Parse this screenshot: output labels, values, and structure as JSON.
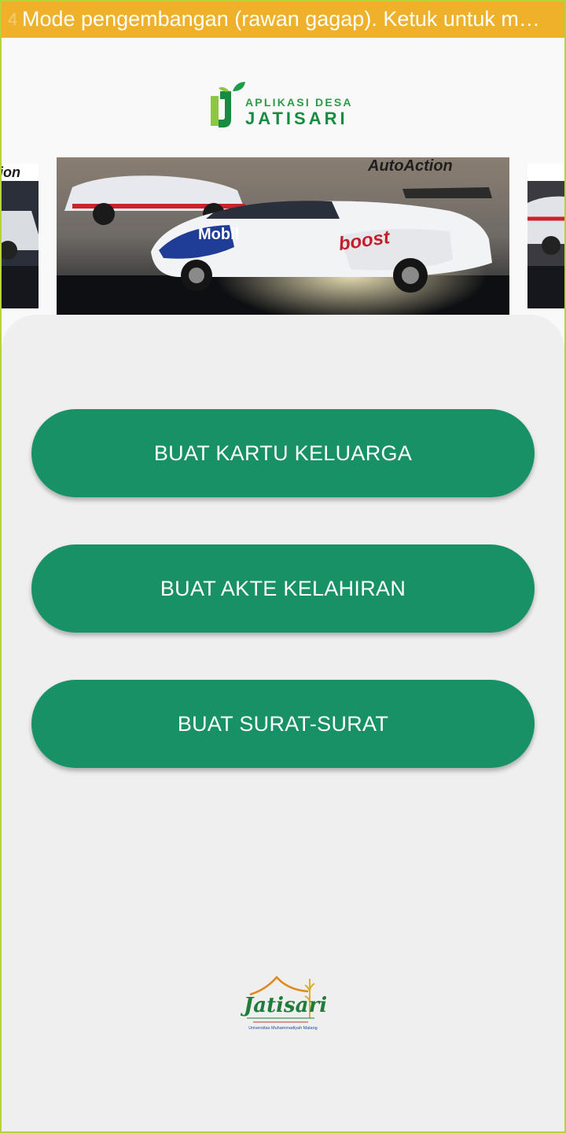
{
  "dev_banner": {
    "text": "Mode pengembangan (rawan gagap). Ketuk untuk m…",
    "ghost_text": "4"
  },
  "header_logo": {
    "line1": "APLIKASI DESA",
    "line2": "JATISARI"
  },
  "carousel": {
    "banner_text": "AutoAction",
    "car_sponsor": "boost",
    "car_brand": "Mobil"
  },
  "menu": {
    "buttons": [
      {
        "label": "BUAT KARTU KELUARGA"
      },
      {
        "label": "BUAT AKTE KELAHIRAN"
      },
      {
        "label": "BUAT SURAT-SURAT"
      }
    ]
  },
  "footer_logo": {
    "title": "Jatisari",
    "tagline": "Universitas Muhammadiyah Malang"
  },
  "colors": {
    "accent": "#199167",
    "banner": "#f0b12a",
    "frame": "#b6d33a",
    "panel": "#efefef",
    "logo_green": "#188b42"
  }
}
